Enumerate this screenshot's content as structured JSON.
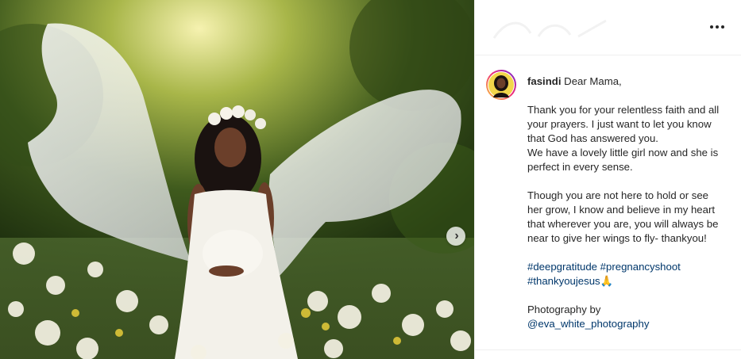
{
  "post": {
    "username": "fasindi",
    "caption_intro": "Dear Mama,",
    "paragraph_1": "Thank you for your relentless faith and all your prayers. I just want to let you know that God has answered you.\nWe have a lovely little girl now and she is perfect in every sense.",
    "paragraph_2": "Though you are not here to hold or see her grow, I know and believe in my heart that wherever you are, you will always be near to give her wings to fly- thankyou!",
    "hashtags": [
      "#deepgratitude",
      "#pregnancyshoot",
      "#thankyoujesus🙏"
    ],
    "photo_credit_label": "Photography by",
    "photo_credit_handle": "@eva_white_photography"
  },
  "icons": {
    "more": "more-horizontal-icon",
    "next": "chevron-right-icon"
  },
  "colors": {
    "text": "#262626",
    "link": "#00376b",
    "border": "#efefef"
  }
}
